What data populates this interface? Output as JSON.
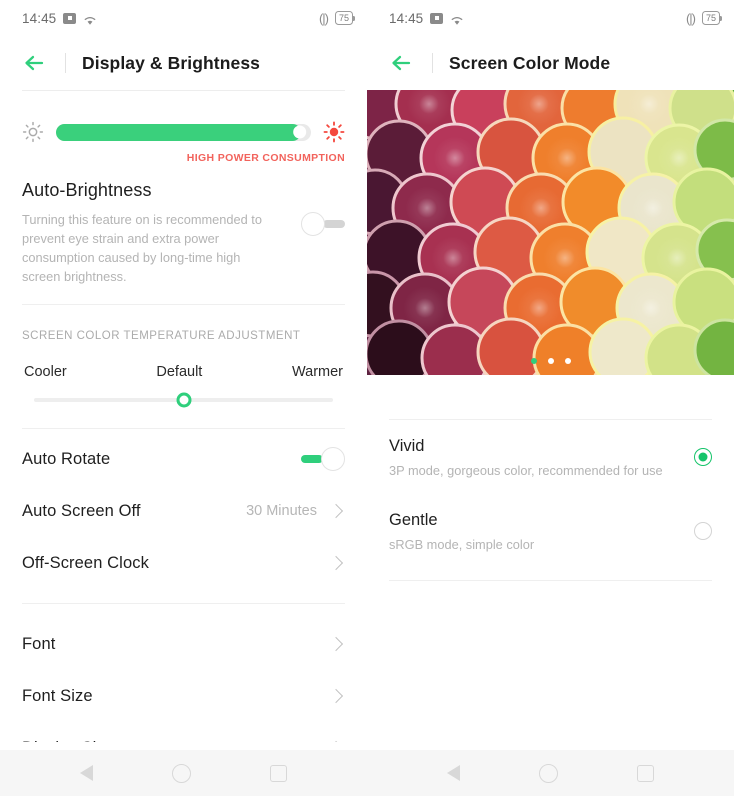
{
  "status_bar": {
    "time": "14:45",
    "icons": [
      "media-icon",
      "wifi-icon"
    ],
    "vibrate_icon": "vibrate-icon",
    "battery_level": "75"
  },
  "left_screen": {
    "title": "Display & Brightness",
    "back_icon": "back-arrow-icon",
    "brightness": {
      "low_icon": "sun-dim-icon",
      "high_icon": "sun-bright-icon",
      "value_percent": 96,
      "warning": "HIGH POWER CONSUMPTION",
      "warning_color": "#f2635c",
      "fill_color": "#3ad07c"
    },
    "auto_brightness": {
      "title": "Auto-Brightness",
      "description": "Turning this feature on is recommended to prevent eye strain and extra power consumption caused by long-time high screen brightness.",
      "enabled": false
    },
    "color_temperature": {
      "section_label": "SCREEN COLOR TEMPERATURE ADJUSTMENT",
      "left_label": "Cooler",
      "center_label": "Default",
      "right_label": "Warmer",
      "position_percent": 50,
      "thumb_color": "#2fcf7c"
    },
    "rows": [
      {
        "label": "Auto Rotate",
        "type": "toggle",
        "enabled": true
      },
      {
        "label": "Auto Screen Off",
        "type": "value",
        "value": "30 Minutes"
      },
      {
        "label": "Off-Screen Clock",
        "type": "link",
        "value": ""
      },
      {
        "label": "Font",
        "type": "link",
        "value": ""
      },
      {
        "label": "Font Size",
        "type": "link",
        "value": ""
      },
      {
        "label": "Display Size",
        "type": "link",
        "value": ""
      }
    ]
  },
  "right_screen": {
    "title": "Screen Color Mode",
    "back_icon": "back-arrow-icon",
    "carousel": {
      "image_alt": "citrus-slices-rainbow",
      "total_dots": 3,
      "active_index": 0,
      "active_color": "#2fcf7c"
    },
    "options": [
      {
        "title": "Vivid",
        "description": "3P mode, gorgeous color, recommended for use",
        "selected": true
      },
      {
        "title": "Gentle",
        "description": "sRGB mode, simple color",
        "selected": false
      }
    ]
  },
  "nav_bar": {
    "back": "nav-back-icon",
    "home": "nav-home-icon",
    "recents": "nav-recents-icon"
  }
}
